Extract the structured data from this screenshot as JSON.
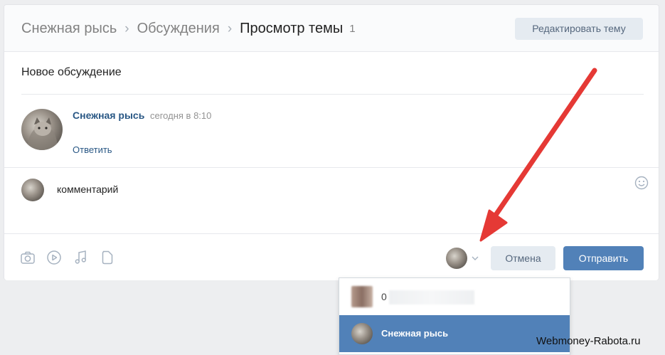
{
  "breadcrumb": {
    "items": [
      "Снежная рысь",
      "Обсуждения"
    ],
    "separator": "›",
    "current": "Просмотр темы",
    "count": "1"
  },
  "header": {
    "edit_button": "Редактировать тему"
  },
  "topic": {
    "title": "Новое обсуждение"
  },
  "post": {
    "author": "Снежная рысь",
    "time": "сегодня в 8:10",
    "reply": "Ответить"
  },
  "comment": {
    "text": "комментарий"
  },
  "footer": {
    "attachments": [
      "camera-icon",
      "video-icon",
      "music-icon",
      "document-icon"
    ],
    "cancel": "Отмена",
    "send": "Отправить"
  },
  "dropdown": {
    "items": [
      {
        "label": "0",
        "selected": false
      },
      {
        "label": "Снежная рысь",
        "selected": true
      }
    ]
  },
  "watermark": "Webmoney-Rabota.ru",
  "colors": {
    "accent": "#5181b8",
    "link": "#2a5885",
    "arrow": "#e53935",
    "page_bg": "#edeef0"
  }
}
